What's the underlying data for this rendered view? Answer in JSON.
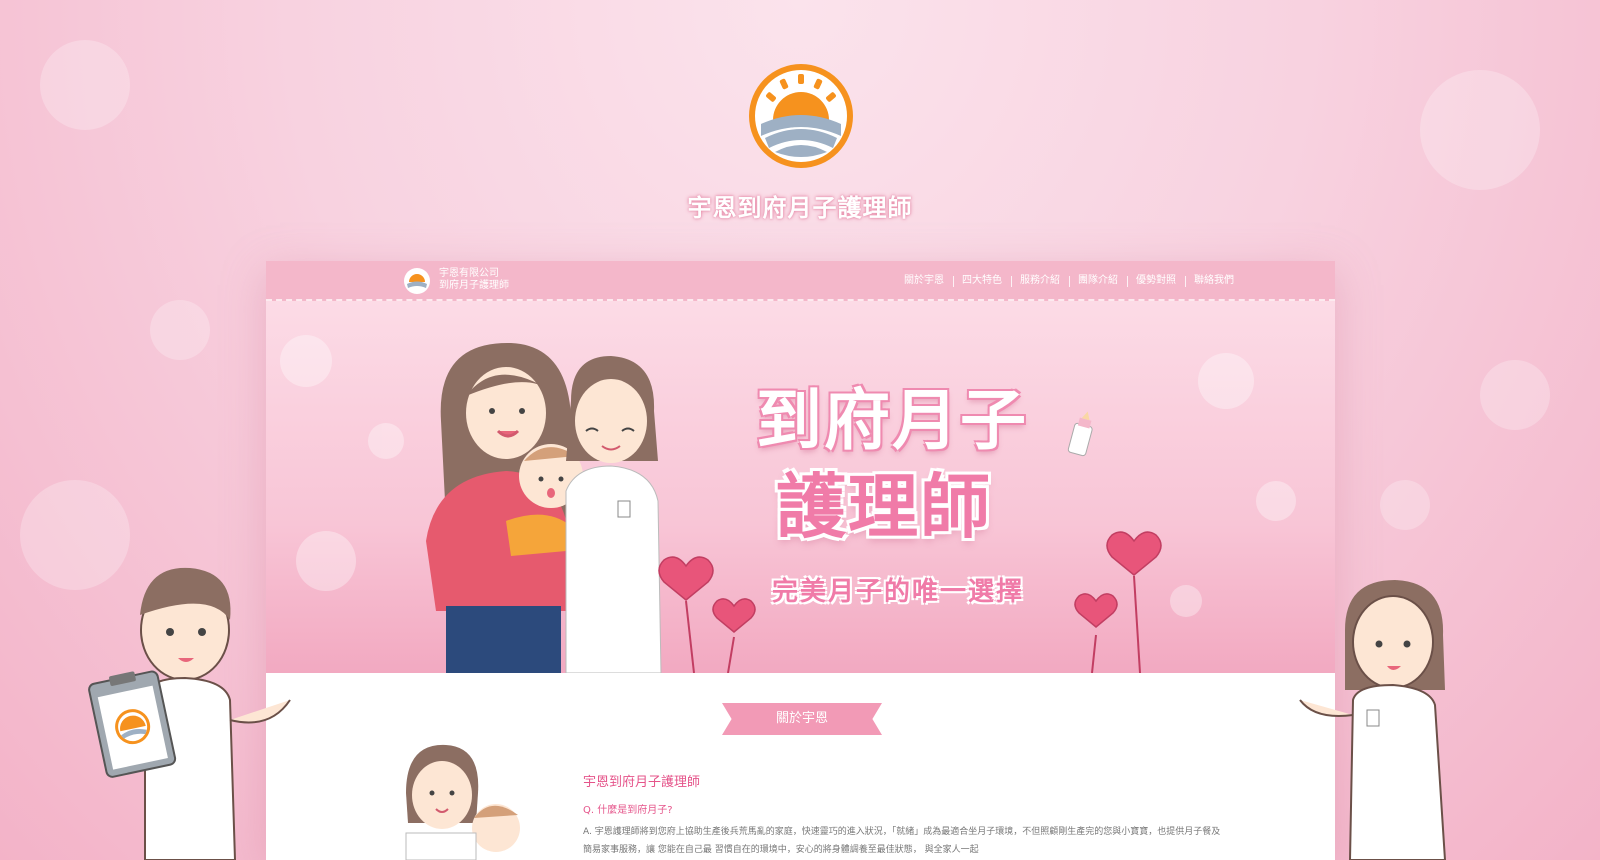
{
  "brand": {
    "title": "宇恩到府月子護理師",
    "colors": {
      "accent": "#f07ba8",
      "orange": "#f6921e",
      "nav_pink": "#f4b7ca"
    }
  },
  "site": {
    "logo_line1": "宇恩有限公司",
    "logo_line2": "到府月子護理師",
    "menu": [
      {
        "label": "關於宇恩",
        "active": true
      },
      {
        "label": "四大特色",
        "active": false
      },
      {
        "label": "服務介紹",
        "active": false
      },
      {
        "label": "團隊介紹",
        "active": false
      },
      {
        "label": "優勢對照",
        "active": false
      },
      {
        "label": "聯絡我們",
        "active": false
      }
    ]
  },
  "hero": {
    "title_line1": "到府月子",
    "title_line2": "護理師",
    "subtitle": "完美月子的唯一選擇"
  },
  "about": {
    "ribbon": "關於宇恩",
    "heading": "宇恩到府月子護理師",
    "question": "Q. 什麼是到府月子?",
    "answer": "A. 宇恩護理師將到您府上協助生產後兵荒馬亂的家庭，快速靈巧的進入狀況，「就緒」成為最適合坐月子環境，不但照顧剛生產完的您與小寶寶，也提供月子餐及簡易家事服務，讓 您能在自己最 習慣自在的環境中，安心的將身體調養至最佳狀態， 與全家人一起"
  }
}
